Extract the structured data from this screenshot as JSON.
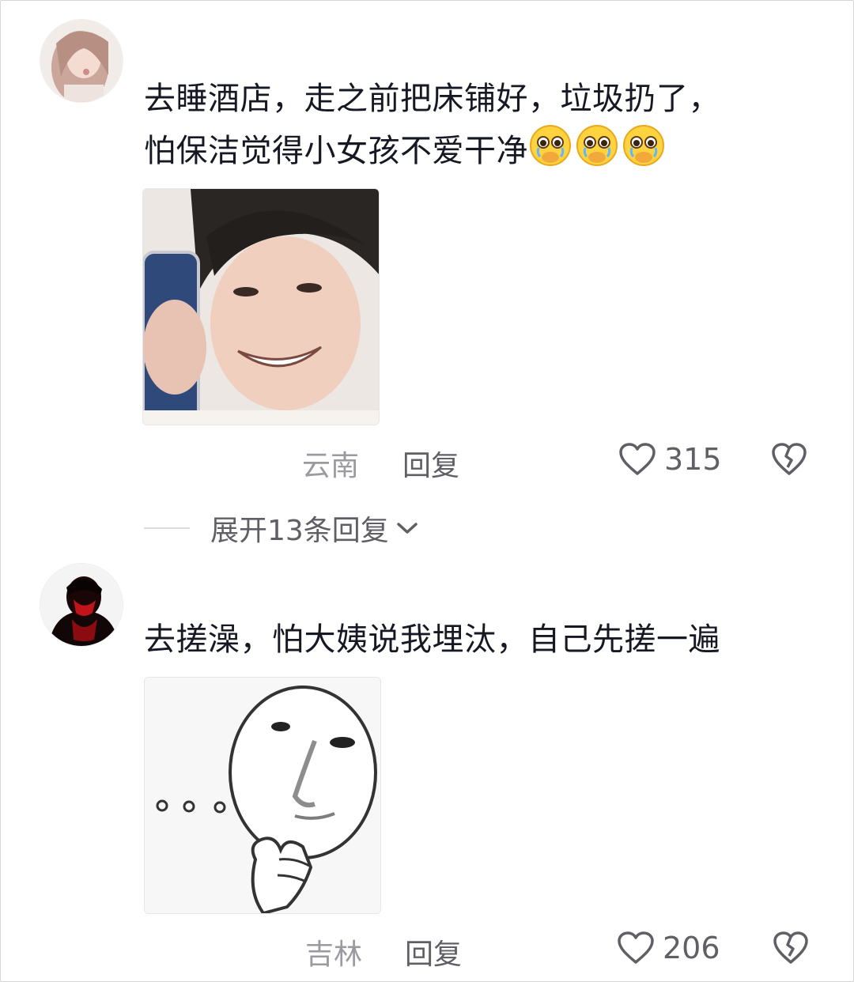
{
  "comments": [
    {
      "text_line1": "去睡酒店，走之前把床铺好，垃圾扔了，",
      "text_line2": "怕保洁觉得小女孩不爱干净",
      "emojis": [
        "pleading-crying-face-icon",
        "pleading-crying-face-icon",
        "pleading-crying-face-icon"
      ],
      "location": "云南",
      "reply_label": "回复",
      "likes": "315"
    },
    {
      "text_line1": "去搓澡，怕大姨说我埋汰，自己先搓一遍",
      "location": "吉林",
      "reply_label": "回复",
      "likes": "206"
    }
  ],
  "expand_replies": {
    "label": "展开13条回复"
  },
  "colors": {
    "text": "#161823",
    "meta": "#9a9aa0",
    "action": "#5f5f66",
    "divider": "#dcdcdc"
  }
}
